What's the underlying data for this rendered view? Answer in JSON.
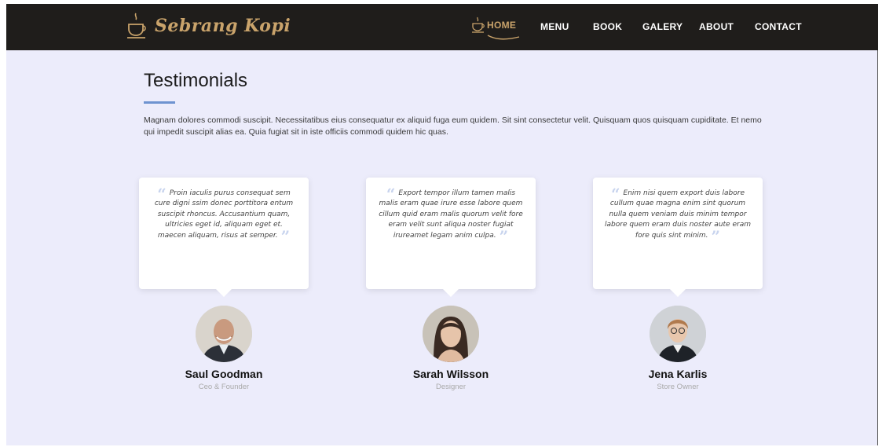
{
  "brand": {
    "name": "Sebrang Kopi",
    "icon": "coffee-cup-icon",
    "color": "#c9a36b"
  },
  "nav": {
    "items": [
      {
        "label": "HOME",
        "active": true
      },
      {
        "label": "MENU",
        "active": false
      },
      {
        "label": "BOOK",
        "active": false
      },
      {
        "label": "GALERY",
        "active": false
      },
      {
        "label": "ABOUT",
        "active": false
      },
      {
        "label": "CONTACT",
        "active": false
      }
    ]
  },
  "section": {
    "title": "Testimonials",
    "accent": "#6e93d0",
    "intro": "Magnam dolores commodi suscipit. Necessitatibus eius consequatur ex aliquid fuga eum quidem. Sit sint consectetur velit. Quisquam quos quisquam cupiditate. Et nemo qui impedit suscipit alias ea. Quia fugiat sit in iste officiis commodi quidem hic quas."
  },
  "testimonials": [
    {
      "quote": "Proin iaculis purus consequat sem cure digni  ssim donec porttitora entum suscipit rhoncus. Accusantium quam, ultricies eget id, aliquam eget et. maecen aliquam, risus at semper.",
      "name": "Saul Goodman",
      "role": "Ceo & Founder"
    },
    {
      "quote": "Export tempor illum tamen malis malis eram quae irure esse labore quem cillum quid eram malis quorum velit fore eram velit sunt aliqua noster fugiat irureamet legam anim culpa.",
      "name": "Sarah Wilsson",
      "role": "Designer"
    },
    {
      "quote": "Enim nisi quem export duis labore cullum quae magna enim sint quorum nulla quem veniam duis minim tempor labore quem eram duis noster aute eram fore quis sint minim.",
      "name": "Jena Karlis",
      "role": "Store Owner"
    }
  ]
}
